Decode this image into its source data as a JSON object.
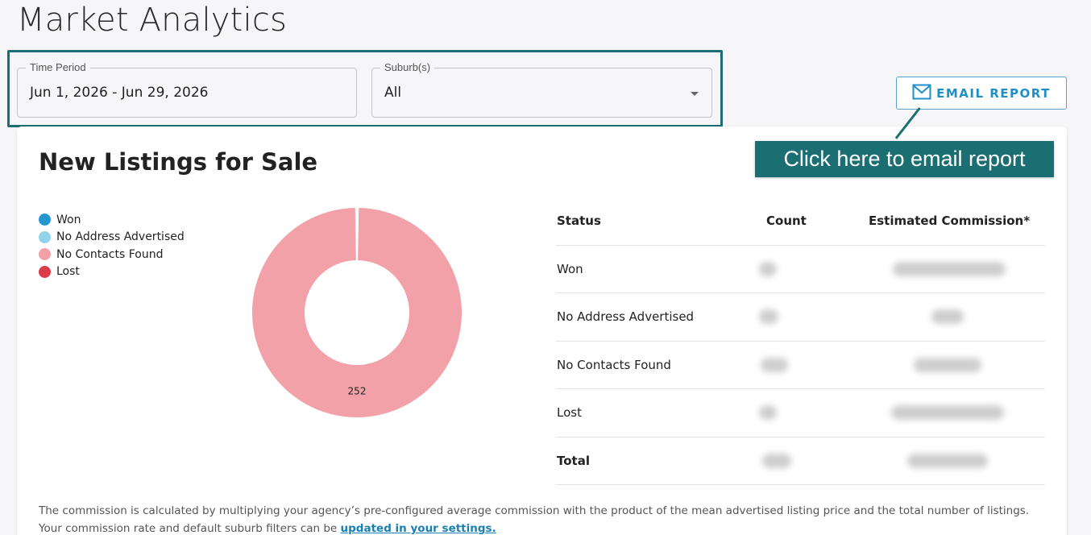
{
  "page": {
    "title": "Market Analytics"
  },
  "filters": {
    "time_period": {
      "label": "Time Period",
      "value": "Jun 1, 2026 - Jun 29, 2026"
    },
    "suburbs": {
      "label": "Suburb(s)",
      "value": "All"
    }
  },
  "email_button": {
    "label": "EMAIL REPORT",
    "icon": "mail-icon"
  },
  "callout": {
    "text": "Click here to email report",
    "color": "#1b6f73"
  },
  "card": {
    "title": "New Listings for Sale"
  },
  "legend": [
    {
      "label": "Won",
      "color": "#2497cf"
    },
    {
      "label": "No Address Advertised",
      "color": "#92d3ec"
    },
    {
      "label": "No Contacts Found",
      "color": "#f2a1a8"
    },
    {
      "label": "Lost",
      "color": "#dc3b49"
    }
  ],
  "chart_data": {
    "type": "pie",
    "labels": [
      "Won",
      "No Address Advertised",
      "No Contacts Found",
      "Lost"
    ],
    "values": [
      0,
      0,
      252,
      0
    ],
    "slice_labels": [
      "",
      "",
      "252",
      ""
    ],
    "donut": true
  },
  "table": {
    "headers": [
      "Status",
      "Count",
      "Estimated Commission*"
    ],
    "rows": [
      {
        "status": "Won"
      },
      {
        "status": "No Address Advertised"
      },
      {
        "status": "No Contacts Found"
      },
      {
        "status": "Lost"
      },
      {
        "status": "Total"
      }
    ]
  },
  "footnote": {
    "line1": "The commission is calculated by multiplying your agency’s pre-configured average commission with the product of the mean advertised listing price and the total number of listings.",
    "line2": "Your commission rate and default suburb filters can be ",
    "link": "updated in your settings."
  }
}
